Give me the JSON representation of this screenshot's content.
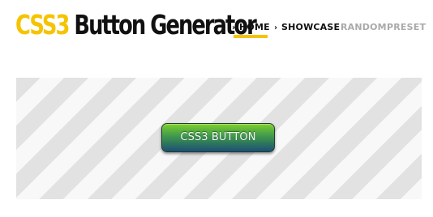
{
  "logo": {
    "accent_text": "CSS3",
    "rest_text": " Button Generator"
  },
  "nav": {
    "items": [
      {
        "label": "HOME",
        "active": true,
        "icon": "chevron-right-icon"
      },
      {
        "label": "SHOWCASE",
        "active": false,
        "icon": "chevron-right-icon"
      },
      {
        "label": "RANDOM",
        "active": false
      },
      {
        "label": "PRESET",
        "active": false
      }
    ],
    "chevron_glyph": "›"
  },
  "preview": {
    "button_label": "CSS3 BUTTON"
  },
  "colors": {
    "brand_yellow": "#f5c400",
    "text_dark": "#111111",
    "nav_inactive": "#aaaaaa",
    "stripe_dark": "#e2e2e2",
    "stripe_light": "#f8f8f8",
    "button_top": "#7ed12a",
    "button_bottom": "#1d4f78"
  }
}
